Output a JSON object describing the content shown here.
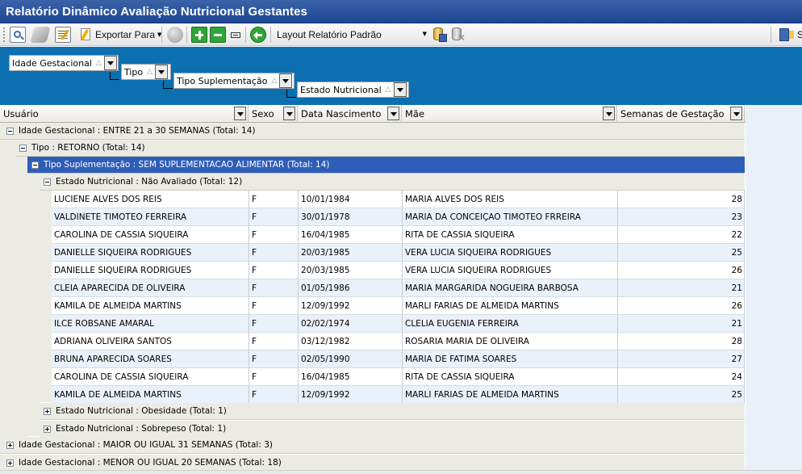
{
  "window": {
    "title": "Relatório Dinâmico Avaliação Nutricional Gestantes"
  },
  "toolbar": {
    "export_label": "Exportar Para",
    "layout_label": "Layout Relatório",
    "layout_value": "Padrão",
    "icons": [
      "print-preview-icon",
      "eraser-icon",
      "edit-icon",
      "filter-icon",
      "globe-icon",
      "expand-all-icon",
      "collapse-all-icon",
      "fit-icon",
      "refresh-icon",
      "save-layout-icon",
      "delete-layout-icon",
      "exit-icon"
    ]
  },
  "group_panel": {
    "chips": [
      {
        "label": "Idade Gestacional"
      },
      {
        "label": "Tipo"
      },
      {
        "label": "Tipo Suplementação"
      },
      {
        "label": "Estado Nutricional"
      }
    ],
    "sort_glyph": "△"
  },
  "grid": {
    "columns": [
      {
        "label": "Usuário"
      },
      {
        "label": "Sexo"
      },
      {
        "label": "Data Nascimento"
      },
      {
        "label": "Mãe"
      },
      {
        "label": "Semanas de Gestação"
      }
    ],
    "groups": {
      "g1": "Idade Gestacional : ENTRE 21 a 30 SEMANAS (Total: 14)",
      "g2": "Tipo : RETORNO (Total: 14)",
      "g3": "Tipo Suplementação : SEM SUPLEMENTACAO ALIMENTAR (Total: 14)",
      "g4": "Estado Nutricional : Não Avaliado (Total: 12)",
      "g5": "Estado Nutricional : Obesidade (Total: 1)",
      "g6": "Estado Nutricional : Sobrepeso (Total: 1)",
      "g7": "Idade Gestacional : MAIOR OU IGUAL 31 SEMANAS (Total: 3)",
      "g8": "Idade Gestacional : MENOR OU IGUAL 20 SEMANAS (Total: 18)"
    },
    "rows": [
      {
        "usuario": "LUCIENE ALVES DOS REIS",
        "sexo": "F",
        "nasc": "10/01/1984",
        "mae": "MARIA ALVES DOS REIS",
        "semanas": "28"
      },
      {
        "usuario": "VALDINETE TIMOTEO FERREIRA",
        "sexo": "F",
        "nasc": "30/01/1978",
        "mae": "MARIA DA CONCEIÇAO TIMOTEO FRREIRA",
        "semanas": "23"
      },
      {
        "usuario": "CAROLINA DE CASSIA SIQUEIRA",
        "sexo": "F",
        "nasc": "16/04/1985",
        "mae": "RITA DE CASSIA SIQUEIRA",
        "semanas": "22"
      },
      {
        "usuario": "DANIELLE SIQUEIRA RODRIGUES",
        "sexo": "F",
        "nasc": "20/03/1985",
        "mae": "VERA LUCIA SIQUEIRA RODRIGUES",
        "semanas": "25"
      },
      {
        "usuario": "DANIELLE SIQUEIRA RODRIGUES",
        "sexo": "F",
        "nasc": "20/03/1985",
        "mae": "VERA LUCIA SIQUEIRA RODRIGUES",
        "semanas": "26"
      },
      {
        "usuario": "CLEIA APARECIDA DE OLIVEIRA",
        "sexo": "F",
        "nasc": "01/05/1986",
        "mae": "MARIA MARGARIDA NOGUEIRA BARBOSA",
        "semanas": "21"
      },
      {
        "usuario": "KAMILA DE ALMEIDA MARTINS",
        "sexo": "F",
        "nasc": "12/09/1992",
        "mae": "MARLI FARIAS DE ALMEIDA MARTINS",
        "semanas": "26"
      },
      {
        "usuario": "ILCE ROBSANE AMARAL",
        "sexo": "F",
        "nasc": "02/02/1974",
        "mae": "CLELIA EUGENIA FERREIRA",
        "semanas": "21"
      },
      {
        "usuario": "ADRIANA OLIVEIRA SANTOS",
        "sexo": "F",
        "nasc": "03/12/1982",
        "mae": "ROSARIA MARIA DE OLIVEIRA",
        "semanas": "28"
      },
      {
        "usuario": "BRUNA APARECIDA SOARES",
        "sexo": "F",
        "nasc": "02/05/1990",
        "mae": "MARIA DE FATIMA SOARES",
        "semanas": "27"
      },
      {
        "usuario": "CAROLINA DE CASSIA SIQUEIRA",
        "sexo": "F",
        "nasc": "16/04/1985",
        "mae": "RITA DE CASSIA SIQUEIRA",
        "semanas": "24"
      },
      {
        "usuario": "KAMILA DE ALMEIDA MARTINS",
        "sexo": "F",
        "nasc": "12/09/1992",
        "mae": "MARLI FARIAS DE ALMEIDA MARTINS",
        "semanas": "25"
      }
    ]
  },
  "colors": {
    "title_bar": "#2a559e",
    "group_area": "#0c6fb0",
    "selected_group": "#2f5eb9",
    "alt_row": "#e9f2fb"
  }
}
